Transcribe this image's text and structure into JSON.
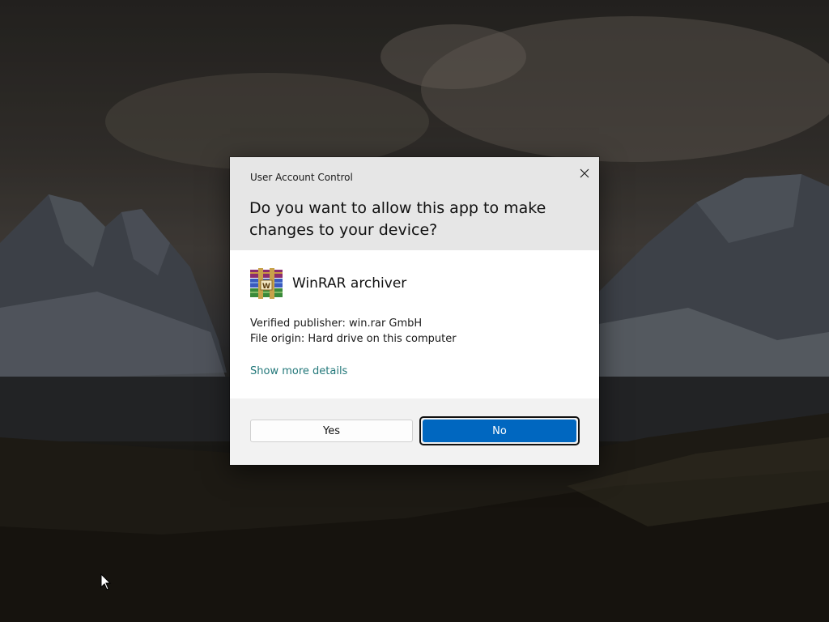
{
  "dialog": {
    "title": "User Account Control",
    "question": "Do you want to allow this app to make changes to your device?",
    "app_name": "WinRAR archiver",
    "publisher": "Verified publisher: win.rar GmbH",
    "origin": "File origin: Hard drive on this computer",
    "more_details": "Show more details",
    "yes_label": "Yes",
    "no_label": "No",
    "close_icon": "close-icon",
    "app_icon": "winrar-icon"
  },
  "colors": {
    "accent": "#0067c0",
    "link": "#23787a",
    "header_bg": "#e6e6e6",
    "footer_bg": "#f2f2f2"
  }
}
